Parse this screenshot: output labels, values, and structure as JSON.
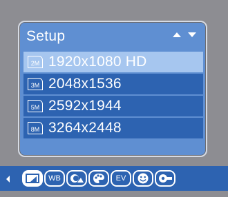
{
  "panel": {
    "title": "Setup"
  },
  "resolutions": [
    {
      "icon_text": "2M",
      "label": "1920x1080 HD",
      "selected": true
    },
    {
      "icon_text": "3M",
      "label": "2048x1536",
      "selected": false
    },
    {
      "icon_text": "5M",
      "label": "2592x1944",
      "selected": false
    },
    {
      "icon_text": "8M",
      "label": "3264x2448",
      "selected": false
    }
  ],
  "toolbar": {
    "wb_label": "WB",
    "ev_label": "EV",
    "icons": [
      "image-size-icon",
      "white-balance-icon",
      "scene-mode-icon",
      "color-effect-icon",
      "exposure-icon",
      "face-detect-icon",
      "settings-icon"
    ]
  },
  "colors": {
    "background": "#8d8d92",
    "panel": "#5f8fd2",
    "row": "#2d63b1",
    "row_selected": "#a6c6ef"
  }
}
